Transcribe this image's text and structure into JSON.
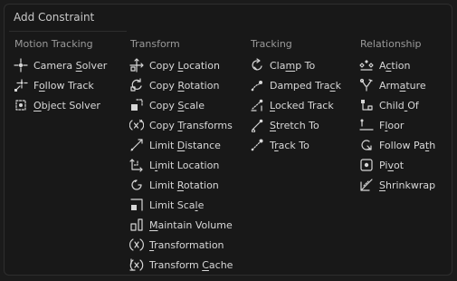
{
  "menu": {
    "title": "Add Constraint"
  },
  "columns": [
    {
      "header": "Motion Tracking",
      "items": [
        {
          "label": "Camera Solver",
          "icon": "camera-solver-icon"
        },
        {
          "label": "Follow Track",
          "icon": "follow-track-icon"
        },
        {
          "label": "Object Solver",
          "icon": "object-solver-icon"
        }
      ]
    },
    {
      "header": "Transform",
      "items": [
        {
          "label": "Copy Location",
          "icon": "copy-location-icon"
        },
        {
          "label": "Copy Rotation",
          "icon": "copy-rotation-icon"
        },
        {
          "label": "Copy Scale",
          "icon": "copy-scale-icon"
        },
        {
          "label": "Copy Transforms",
          "icon": "copy-transforms-icon"
        },
        {
          "label": "Limit Distance",
          "icon": "limit-distance-icon"
        },
        {
          "label": "Limit Location",
          "icon": "limit-location-icon"
        },
        {
          "label": "Limit Rotation",
          "icon": "limit-rotation-icon"
        },
        {
          "label": "Limit Scale",
          "icon": "limit-scale-icon"
        },
        {
          "label": "Maintain Volume",
          "icon": "maintain-volume-icon"
        },
        {
          "label": "Transformation",
          "icon": "transformation-icon"
        },
        {
          "label": "Transform Cache",
          "icon": "transform-cache-icon"
        }
      ]
    },
    {
      "header": "Tracking",
      "items": [
        {
          "label": "Clamp To",
          "icon": "clamp-to-icon"
        },
        {
          "label": "Damped Track",
          "icon": "damped-track-icon"
        },
        {
          "label": "Locked Track",
          "icon": "locked-track-icon"
        },
        {
          "label": "Stretch To",
          "icon": "stretch-to-icon"
        },
        {
          "label": "Track To",
          "icon": "track-to-icon"
        }
      ]
    },
    {
      "header": "Relationship",
      "items": [
        {
          "label": "Action",
          "icon": "action-icon"
        },
        {
          "label": "Armature",
          "icon": "armature-icon"
        },
        {
          "label": "Child Of",
          "icon": "child-of-icon"
        },
        {
          "label": "Floor",
          "icon": "floor-icon"
        },
        {
          "label": "Follow Path",
          "icon": "follow-path-icon"
        },
        {
          "label": "Pivot",
          "icon": "pivot-icon"
        },
        {
          "label": "Shrinkwrap",
          "icon": "shrinkwrap-icon"
        }
      ]
    }
  ]
}
